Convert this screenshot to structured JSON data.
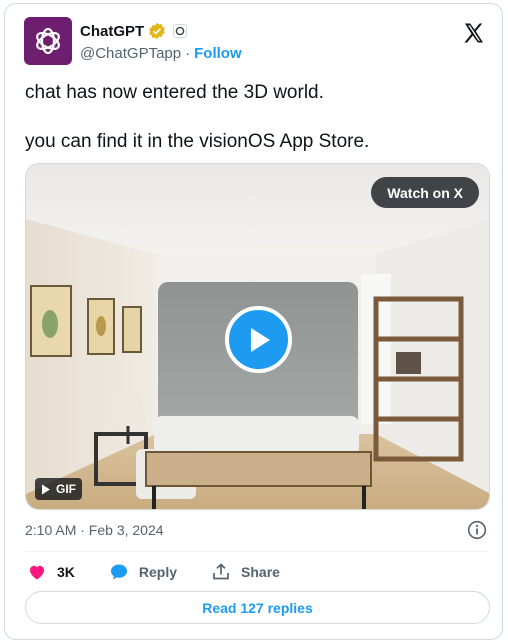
{
  "author": {
    "name": "ChatGPT",
    "handle": "@ChatGPTapp",
    "separator": "·",
    "follow_label": "Follow"
  },
  "tweet": {
    "lines": [
      "chat has now entered the 3D world.",
      "you can find it in the visionOS App Store."
    ]
  },
  "media": {
    "watch_label": "Watch on X",
    "gif_label": "GIF"
  },
  "meta": {
    "timestamp": "2:10 AM · Feb 3, 2024"
  },
  "actions": {
    "likes": "3K",
    "reply_label": "Reply",
    "share_label": "Share"
  },
  "replies_button": "Read 127 replies",
  "colors": {
    "accent": "#1d9bf0",
    "like": "#f91880",
    "avatar_bg": "#6e1e6f",
    "verified": "#e2b719"
  }
}
